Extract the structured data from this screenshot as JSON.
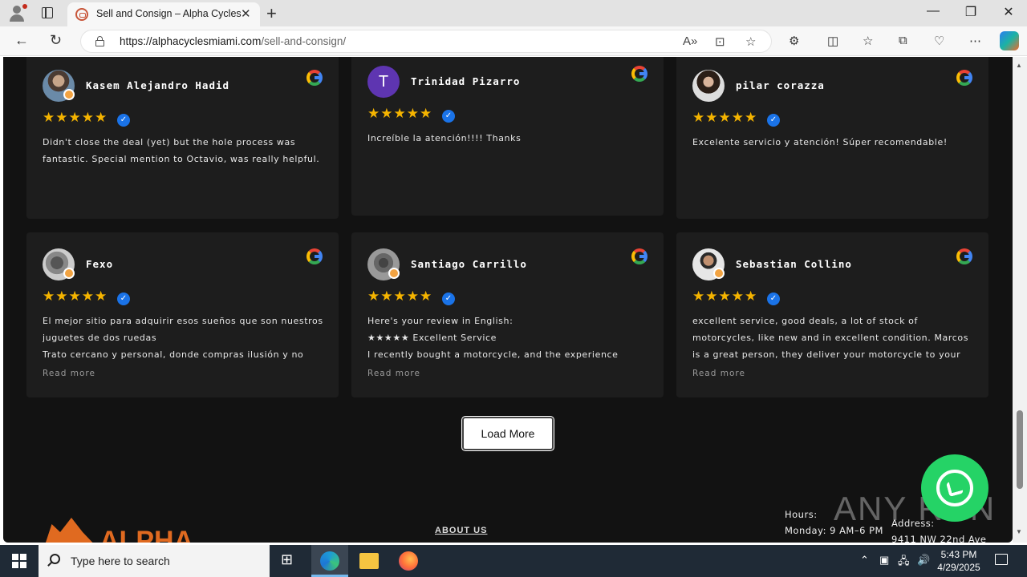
{
  "browser": {
    "tab_title": "Sell and Consign – Alpha Cycles",
    "url_domain": "https://alphacyclesmiami.com",
    "url_path": "/sell-and-consign/"
  },
  "reviews": [
    {
      "name": "Kasem Alejandro Hadid",
      "stars": "★★★★★",
      "text": "Didn't close the deal (yet) but the hole process was fantastic. Special mention to Octavio, was really helpful.",
      "read_more": ""
    },
    {
      "name": "Trinidad Pizarro",
      "initial": "T",
      "stars": "★★★★★",
      "text": "Increíble la atención!!!! Thanks",
      "read_more": ""
    },
    {
      "name": "pilar corazza",
      "stars": "★★★★★",
      "text": "Excelente servicio y atención! Súper recomendable!",
      "read_more": ""
    },
    {
      "name": "Fexo",
      "stars": "★★★★★",
      "text": "El mejor sitio para adquirir esos sueños que son nuestros juguetes de dos ruedas\nTrato cercano y personal, donde compras ilusión y no problemas.",
      "read_more": "Read more"
    },
    {
      "name": "Santiago Carrillo",
      "stars": "★★★★★",
      "text": "Here's your review in English:\n★★★★★ Excellent Service\nI recently bought a motorcycle, and the experience couldn't",
      "read_more": "Read more"
    },
    {
      "name": "Sebastian Collino",
      "stars": "★★★★★",
      "text": "excellent service, good deals, a lot of stock of motorcycles, like new and in excellent condition. Marcos is a great person, they deliver your motorcycle to your house. excellent after-sales",
      "read_more": "Read more"
    }
  ],
  "load_more_label": "Load More",
  "footer": {
    "logo_word": "ALPHA",
    "about_label": "ABOUT US",
    "hours_label": "Hours:",
    "hours_line": "Monday: 9 AM–6 PM",
    "address_label": "Address:",
    "address_line": "9411 NW 22nd Ave"
  },
  "watermark": "ANY RUN",
  "taskbar": {
    "search_placeholder": "Type here to search",
    "time": "5:43 PM",
    "date": "4/29/2025"
  }
}
